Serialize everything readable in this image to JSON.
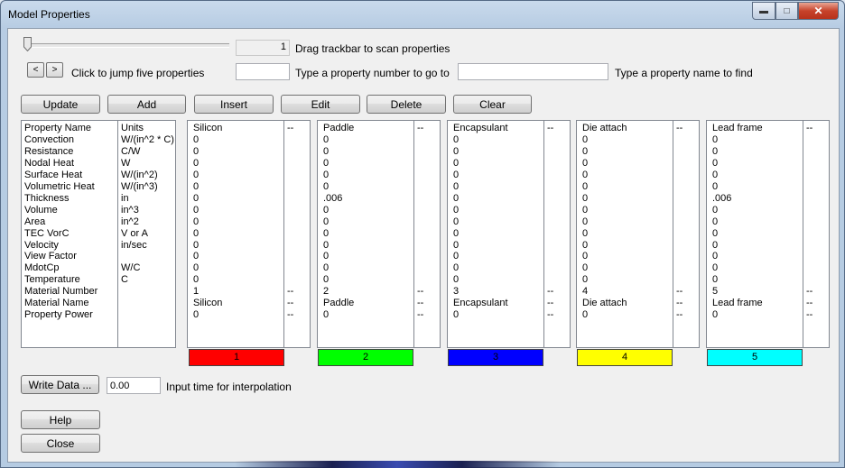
{
  "window": {
    "title": "Model Properties"
  },
  "trackbar": {
    "value": "1",
    "label": "Drag trackbar to scan properties"
  },
  "jump": {
    "prev": "<",
    "next": ">",
    "label": "Click to jump five properties"
  },
  "goto": {
    "value": "",
    "label": "Type a property number to go to"
  },
  "find": {
    "value": "",
    "label": "Type a property name to find"
  },
  "toolbar": {
    "update": "Update",
    "add": "Add",
    "insert": "Insert",
    "edit": "Edit",
    "delete": "Delete",
    "clear": "Clear"
  },
  "properties": {
    "names": "Property Name\nConvection\nResistance\nNodal Heat\nSurface Heat\nVolumetric Heat\nThickness\nVolume\nArea\nTEC VorC\nVelocity\nView Factor\nMdotCp\nTemperature\nMaterial Number\nMaterial Name\nProperty Power",
    "units": "Units\nW/(in^2 * C)\nC/W\nW\nW/(in^2)\nW/(in^3)\nin\nin^3\nin^2\nV or A\nin/sec\n\nW/C\nC\n\n\n"
  },
  "materials": [
    {
      "values": "Silicon\n0\n0\n0\n0\n0\n0\n0\n0\n0\n0\n0\n0\n0\n1\nSilicon\n0",
      "flags": "--\n\n\n\n\n\n\n\n\n\n\n\n\n\n--\n--\n--",
      "swatch_label": "1",
      "color": "#ff0000"
    },
    {
      "values": "Paddle\n0\n0\n0\n0\n0\n.006\n0\n0\n0\n0\n0\n0\n0\n2\nPaddle\n0",
      "flags": "--\n\n\n\n\n\n\n\n\n\n\n\n\n\n--\n--\n--",
      "swatch_label": "2",
      "color": "#00ff00"
    },
    {
      "values": "Encapsulant\n0\n0\n0\n0\n0\n0\n0\n0\n0\n0\n0\n0\n0\n3\nEncapsulant\n0",
      "flags": "--\n\n\n\n\n\n\n\n\n\n\n\n\n\n--\n--\n--",
      "swatch_label": "3",
      "color": "#0000ff"
    },
    {
      "values": "Die attach\n0\n0\n0\n0\n0\n0\n0\n0\n0\n0\n0\n0\n0\n4\nDie attach\n0",
      "flags": "--\n\n\n\n\n\n\n\n\n\n\n\n\n\n--\n--\n--",
      "swatch_label": "4",
      "color": "#ffff00"
    },
    {
      "values": "Lead frame\n0\n0\n0\n0\n0\n.006\n0\n0\n0\n0\n0\n0\n0\n5\nLead frame\n0",
      "flags": "--\n\n\n\n\n\n\n\n\n\n\n\n\n\n--\n--\n--",
      "swatch_label": "5",
      "color": "#00ffff"
    }
  ],
  "interpolation": {
    "button": "Write Data ...",
    "time_value": "0.00",
    "label": "Input time for interpolation"
  },
  "footer": {
    "help": "Help",
    "close": "Close"
  }
}
